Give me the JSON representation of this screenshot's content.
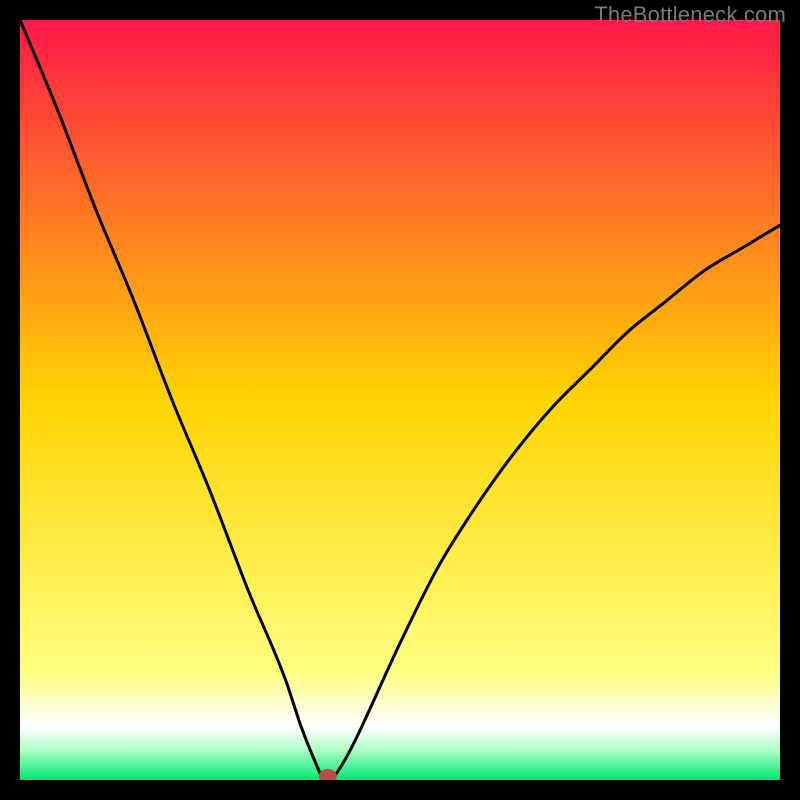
{
  "watermark": "TheBottleneck.com",
  "chart_data": {
    "type": "line",
    "title": "",
    "xlabel": "",
    "ylabel": "",
    "xlim": [
      0,
      100
    ],
    "ylim": [
      0,
      100
    ],
    "grid": false,
    "series": [
      {
        "name": "bottleneck-curve",
        "x": [
          0,
          5,
          10,
          15,
          20,
          25,
          30,
          33,
          35,
          37,
          39,
          40,
          41,
          44,
          50,
          55,
          60,
          65,
          70,
          75,
          80,
          85,
          90,
          95,
          100
        ],
        "y": [
          100,
          88,
          75,
          63,
          50,
          38,
          25,
          18,
          13,
          7,
          2,
          0,
          0,
          5,
          18,
          28,
          36,
          43,
          49,
          54,
          59,
          63,
          67,
          70,
          73
        ]
      }
    ],
    "marker": {
      "x": 40.5,
      "y": 0
    },
    "gradient_stops": [
      {
        "pos": 0.0,
        "color": "#ff1848"
      },
      {
        "pos": 0.5,
        "color": "#ffd400"
      },
      {
        "pos": 0.86,
        "color": "#ffff80"
      },
      {
        "pos": 0.9,
        "color": "#fbffd0"
      },
      {
        "pos": 0.93,
        "color": "#ffffff"
      },
      {
        "pos": 0.96,
        "color": "#b0ffc8"
      },
      {
        "pos": 1.0,
        "color": "#00e870"
      }
    ]
  }
}
